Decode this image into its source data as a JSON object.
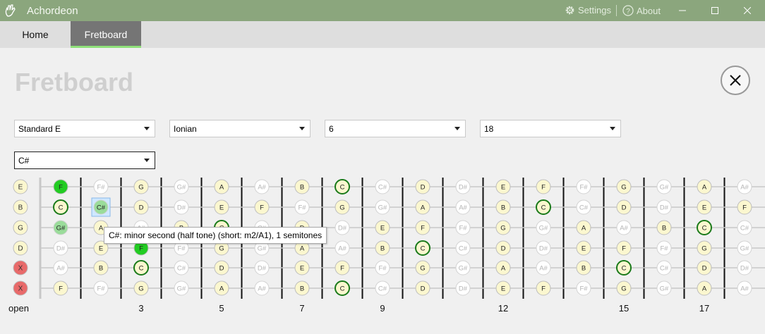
{
  "window": {
    "title": "Achordeon",
    "settings_label": "Settings",
    "about_label": "About"
  },
  "tabs": [
    {
      "label": "Home",
      "active": false
    },
    {
      "label": "Fretboard",
      "active": true
    }
  ],
  "page": {
    "title": "Fretboard"
  },
  "controls": {
    "tuning": "Standard E",
    "mode": "Ionian",
    "strings": "6",
    "frets": "18",
    "key": "C#"
  },
  "fretboard": {
    "open_label": "open",
    "fret_numbers": [
      "3",
      "5",
      "7",
      "9",
      "12",
      "15",
      "17"
    ],
    "strings": [
      {
        "open": "E",
        "open_state": "in-scale",
        "notes": [
          "F",
          "F#",
          "G",
          "G#",
          "A",
          "A#",
          "B",
          "C",
          "C#",
          "D",
          "D#",
          "E",
          "F",
          "F#",
          "G",
          "G#",
          "A",
          "A#"
        ]
      },
      {
        "open": "B",
        "open_state": "in-scale",
        "notes": [
          "C",
          "C#",
          "D",
          "D#",
          "E",
          "F",
          "F#",
          "G",
          "G#",
          "A",
          "A#",
          "B",
          "C",
          "C#",
          "D",
          "D#",
          "E",
          "F"
        ]
      },
      {
        "open": "G",
        "open_state": "in-scale",
        "notes": [
          "G#",
          "A",
          "A#",
          "B",
          "C",
          "C#",
          "D",
          "D#",
          "E",
          "F",
          "F#",
          "G",
          "G#",
          "A",
          "A#",
          "B",
          "C",
          "C#"
        ]
      },
      {
        "open": "D",
        "open_state": "in-scale",
        "notes": [
          "D#",
          "E",
          "F",
          "F#",
          "G",
          "G#",
          "A",
          "A#",
          "B",
          "C",
          "C#",
          "D",
          "D#",
          "E",
          "F",
          "F#",
          "G",
          "G#"
        ]
      },
      {
        "open": "X",
        "open_state": "muted",
        "notes": [
          "A#",
          "B",
          "C",
          "C#",
          "D",
          "D#",
          "E",
          "F",
          "F#",
          "G",
          "G#",
          "A",
          "A#",
          "B",
          "C",
          "C#",
          "D",
          "D#"
        ]
      },
      {
        "open": "X",
        "open_state": "muted",
        "notes": [
          "F",
          "F#",
          "G",
          "G#",
          "A",
          "A#",
          "B",
          "C",
          "C#",
          "D",
          "D#",
          "E",
          "F",
          "F#",
          "G",
          "G#",
          "A",
          "A#"
        ]
      }
    ],
    "in_scale_notes": [
      "C",
      "D",
      "E",
      "F",
      "G",
      "A",
      "B"
    ],
    "root_note": "C",
    "chord_markers": [
      {
        "string": 0,
        "fret": 1,
        "kind": "strong"
      },
      {
        "string": 2,
        "fret": 1,
        "kind": "light"
      },
      {
        "string": 3,
        "fret": 3,
        "kind": "strong"
      },
      {
        "string": 1,
        "fret": 2,
        "kind": "hover"
      }
    ],
    "colors": {
      "in_scale": "#fbf7cf",
      "out_scale": "#ffffff",
      "root_border": "#1a7a1a",
      "strong": "#22cc22",
      "light": "#9adc9a",
      "hover": "#cfe8ff",
      "muted": "#e86a6a"
    }
  },
  "tooltip": {
    "text": "C#: minor second (half tone) (short: m2/A1), 1 semitones"
  }
}
